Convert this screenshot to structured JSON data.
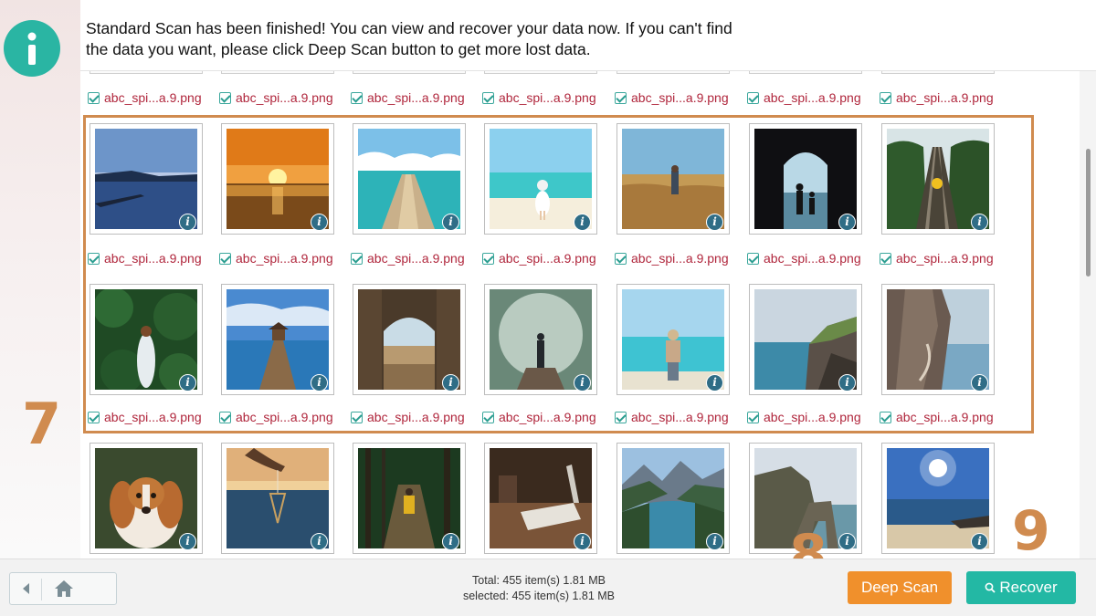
{
  "notice": {
    "icon": "info-icon",
    "message": "Standard Scan has been finished! You can view and recover your data now. If you can't find the data you want, please click Deep Scan button to get more lost data."
  },
  "file_grid": {
    "columns": 7,
    "label_rows": [
      [
        "abc_spi...a.9.png",
        "abc_spi...a.9.png",
        "abc_spi...a.9.png",
        "abc_spi...a.9.png",
        "abc_spi...a.9.png",
        "abc_spi...a.9.png",
        "abc_spi...a.9.png"
      ],
      [
        "abc_spi...a.9.png",
        "abc_spi...a.9.png",
        "abc_spi...a.9.png",
        "abc_spi...a.9.png",
        "abc_spi...a.9.png",
        "abc_spi...a.9.png",
        "abc_spi...a.9.png"
      ],
      [
        "abc_spi...a.9.png",
        "abc_spi...a.9.png",
        "abc_spi...a.9.png",
        "abc_spi...a.9.png",
        "abc_spi...a.9.png",
        "abc_spi...a.9.png",
        "abc_spi...a.9.png"
      ]
    ],
    "thumbnail_rows": [
      [
        "dusk-lake-pier",
        "ocean-sunset",
        "tropical-pier",
        "girl-on-beach",
        "wheat-field-figure",
        "arch-window-silhouettes",
        "forest-railway"
      ],
      [
        "girl-in-forest",
        "wooden-pier-hut",
        "stone-archway",
        "figure-on-misty-pier",
        "traveler-on-beach",
        "rocky-coastline",
        "cliff-staircase"
      ],
      [
        "spaniel-dog",
        "hand-holding-pendant",
        "forest-path-hiker",
        "desk-with-laptop",
        "mountain-fjord",
        "sea-arch-rock",
        "sunny-beach"
      ]
    ]
  },
  "annotations": {
    "selection_marker": "7",
    "deep_scan_marker": "8",
    "recover_marker": "9"
  },
  "bottom_bar": {
    "total_text": "Total: 455 item(s) 1.81 MB",
    "selected_text": "selected: 455 item(s) 1.81 MB",
    "deep_scan_label": "Deep Scan",
    "recover_label": "Recover"
  },
  "colors": {
    "accent_teal": "#23b8a4",
    "deep_scan_orange": "#f0902c",
    "annotation_orange": "#d08b4f",
    "filename_red": "#b0263c"
  }
}
